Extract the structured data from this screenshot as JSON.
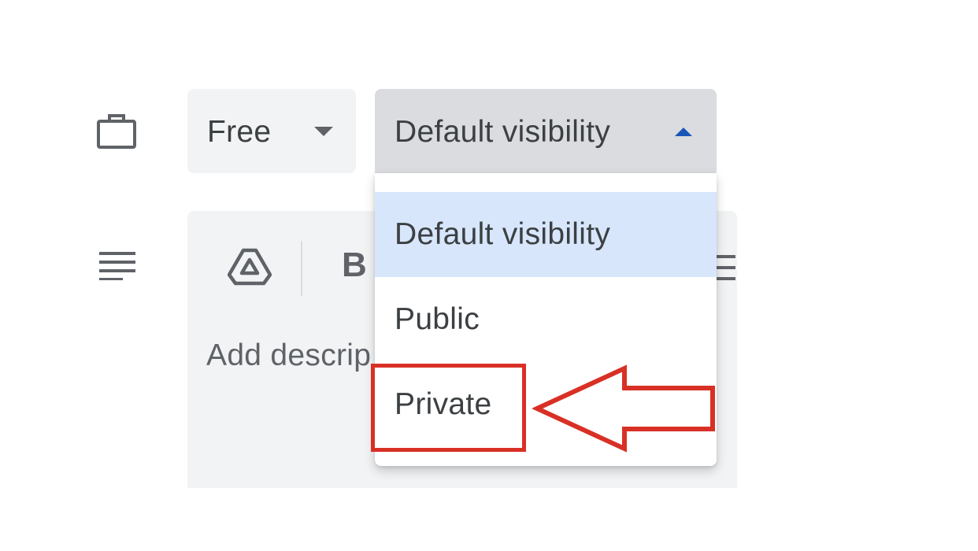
{
  "event_options": {
    "availability": {
      "value": "Free",
      "icon": "caret-down-icon"
    },
    "visibility": {
      "value": "Default visibility",
      "icon": "caret-up-icon",
      "options": [
        "Default visibility",
        "Public",
        "Private"
      ],
      "selected_index": 0
    }
  },
  "description_editor": {
    "placeholder": "Add descrip",
    "toolbar": {
      "bold_label": "B"
    }
  },
  "annotation": {
    "target": "Private",
    "color": "#d93025"
  },
  "colors": {
    "accent": "#1a56b8",
    "field_bg": "#f1f3f4",
    "open_field_bg": "#dadce0",
    "selected_option_bg": "#d7e6fb"
  }
}
